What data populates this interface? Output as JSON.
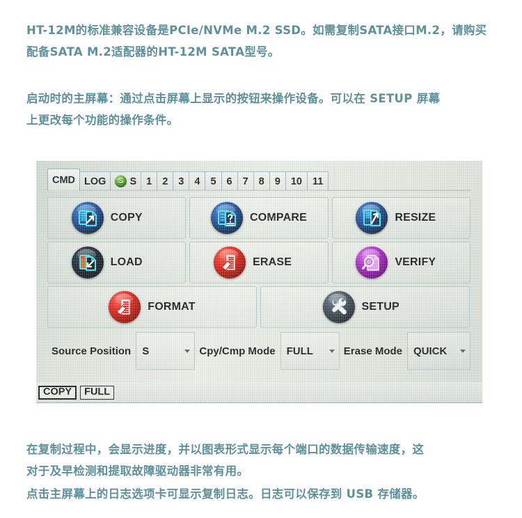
{
  "article": {
    "paragraph_1": "HT-12M的标准兼容设备是PCIe/NVMe M.2 SSD。如需复制SATA接口M.2，请购买\n配备SATA M.2适配器的HT-12M SATA型号。",
    "paragraph_2": "启动时的主屏幕：通过点击屏幕上显示的按钮来操作设备。可以在 SETUP 屏幕\n上更改每个功能的操作条件。",
    "paragraph_3": "在复制过程中，会显示进度，并以图表形式显示每个端口的数据传输速度，这\n对于及早检测和提取故障驱动器非常有用。",
    "paragraph_4": "点击主屏幕上的日志选项卡可显示复制日志。日志可以保存到 USB 存储器。",
    "text_color": "#5f919c"
  },
  "device": {
    "tabs": [
      {
        "label": "CMD",
        "active": true,
        "badge": null
      },
      {
        "label": "LOG",
        "active": false,
        "badge": null
      },
      {
        "label": "S",
        "active": false,
        "badge": "S",
        "badge_color": "#4faa22"
      },
      {
        "label": "1",
        "active": false,
        "badge": null
      },
      {
        "label": "2",
        "active": false,
        "badge": null
      },
      {
        "label": "3",
        "active": false,
        "badge": null
      },
      {
        "label": "4",
        "active": false,
        "badge": null
      },
      {
        "label": "5",
        "active": false,
        "badge": null
      },
      {
        "label": "6",
        "active": false,
        "badge": null
      },
      {
        "label": "7",
        "active": false,
        "badge": null
      },
      {
        "label": "8",
        "active": false,
        "badge": null
      },
      {
        "label": "9",
        "active": false,
        "badge": null
      },
      {
        "label": "10",
        "active": false,
        "badge": null
      },
      {
        "label": "11",
        "active": false,
        "badge": null
      }
    ],
    "functions": [
      {
        "label": "COPY",
        "icon": "copy-document-arrow-icon",
        "color": "#1a4f9e"
      },
      {
        "label": "COMPARE",
        "icon": "compare-document-question-icon",
        "color": "#1a4f9e"
      },
      {
        "label": "RESIZE",
        "icon": "resize-document-arrow-icon",
        "color": "#1a4f9e"
      },
      {
        "label": "LOAD",
        "icon": "load-folder-document-icon",
        "color": "#121a24"
      },
      {
        "label": "ERASE",
        "icon": "erase-document-eraser-icon",
        "color": "#e01b10"
      },
      {
        "label": "VERIFY",
        "icon": "verify-magnifier-document-icon",
        "color": "#a81ec8"
      },
      {
        "label": "FORMAT",
        "icon": "format-document-eraser-icon",
        "color": "#e01b10"
      },
      {
        "label": "SETUP",
        "icon": "wrench-icon",
        "color": "#3a4652"
      }
    ],
    "selectors": [
      {
        "label": "Source Position",
        "value": "S"
      },
      {
        "label": "Cpy/Cmp Mode",
        "value": "FULL"
      },
      {
        "label": "Erase Mode",
        "value": "QUICK"
      }
    ],
    "status_bar": {
      "mode": "COPY",
      "scope": "FULL"
    }
  }
}
